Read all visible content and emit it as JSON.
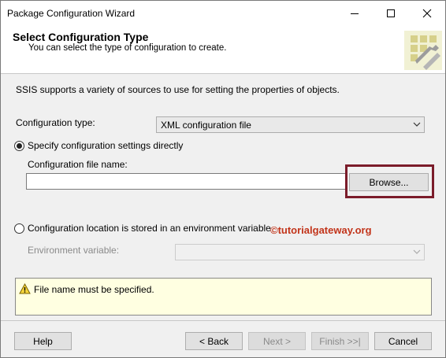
{
  "window": {
    "title": "Package Configuration Wizard"
  },
  "header": {
    "title": "Select Configuration Type",
    "subtitle": "You can select the type of configuration to create."
  },
  "intro": "SSIS supports a variety of sources to use for setting the properties of objects.",
  "config_type": {
    "label": "Configuration type:",
    "value": "XML configuration file"
  },
  "option_direct": {
    "label": "Specify configuration settings directly",
    "selected": true,
    "file_label": "Configuration file name:",
    "file_value": "",
    "browse_label": "Browse..."
  },
  "option_env": {
    "label": "Configuration location is stored in an environment variable",
    "selected": false,
    "env_label": "Environment variable:",
    "env_value": ""
  },
  "watermark": "©tutorialgateway.org",
  "message": {
    "text": "File name must be specified.",
    "icon": "warning-icon"
  },
  "footer": {
    "help": "Help",
    "back": "< Back",
    "next": "Next >",
    "finish": "Finish >>|",
    "cancel": "Cancel"
  },
  "colors": {
    "highlight": "#7b1c2a",
    "watermark": "#c2341a",
    "message_bg": "#ffffe1"
  }
}
